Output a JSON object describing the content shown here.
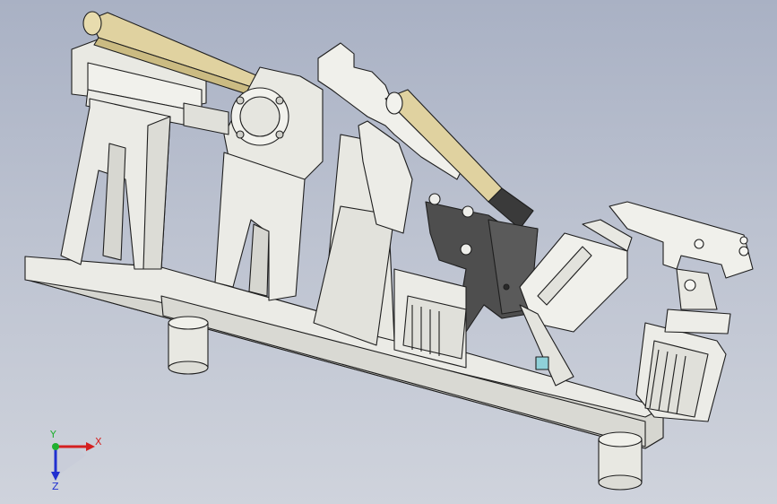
{
  "viewport": {
    "background_top": "#a9b1c4",
    "background_bottom": "#cfd3dc",
    "model_fill": "#ebebe6",
    "model_edge": "#1e1e1e",
    "dark_part": "#4e4e4e",
    "brass_part": "#e0d2a0",
    "accent_cyan": "#8fd0d8"
  },
  "triad": {
    "x_label": "X",
    "y_label": "Y",
    "z_label": "Z",
    "x_color": "#d42020",
    "y_color": "#20b030",
    "z_color": "#2030d0"
  }
}
